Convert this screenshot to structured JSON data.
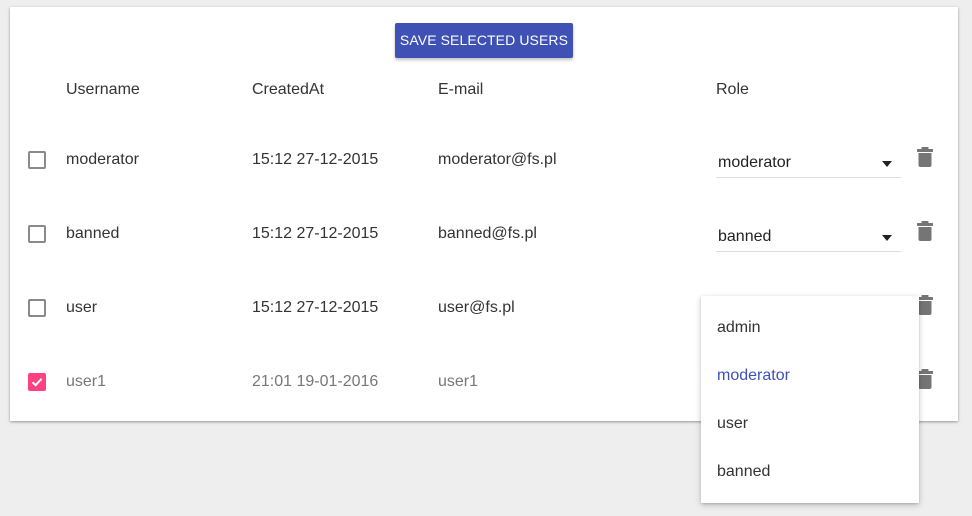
{
  "toolbar": {
    "save_label": "SAVE SELECTED USERS"
  },
  "table": {
    "headers": {
      "username": "Username",
      "created_at": "CreatedAt",
      "email": "E-mail",
      "role": "Role"
    },
    "rows": [
      {
        "selected": false,
        "username": "moderator",
        "created_at": "15:12 27-12-2015",
        "email": "moderator@fs.pl",
        "role": "moderator"
      },
      {
        "selected": false,
        "username": "banned",
        "created_at": "15:12 27-12-2015",
        "email": "banned@fs.pl",
        "role": "banned"
      },
      {
        "selected": false,
        "username": "user",
        "created_at": "15:12 27-12-2015",
        "email": "user@fs.pl",
        "role": ""
      },
      {
        "selected": true,
        "username": "user1",
        "created_at": "21:01 19-01-2016",
        "email": "user1",
        "role": ""
      }
    ]
  },
  "role_dropdown": {
    "options": [
      "admin",
      "moderator",
      "user",
      "banned"
    ],
    "highlighted": "moderator"
  },
  "colors": {
    "accent": "#3f51b5",
    "checkbox_checked": "#ff4081",
    "background": "#eeeeee"
  },
  "icons": {
    "delete": "trash-icon",
    "dropdown": "caret-down-icon",
    "checked": "check-icon"
  }
}
